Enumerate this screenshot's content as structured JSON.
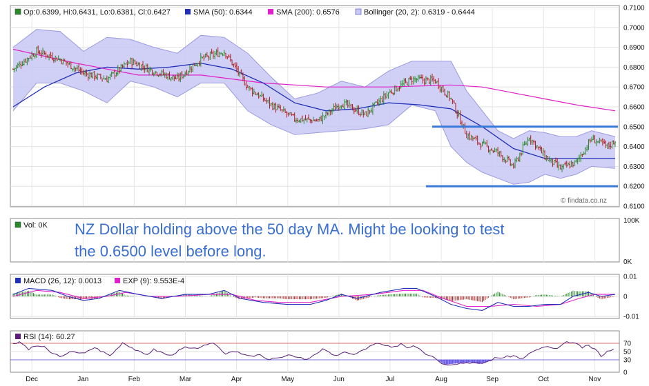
{
  "colors": {
    "up": "#2a8a2a",
    "down": "#b02020",
    "sma50": "#1f2fb8",
    "sma200": "#e020c8",
    "band_fill": "#c8c8f4",
    "band_line": "#9a9ae0",
    "hline": "#3a78d8",
    "macd": "#1f2fb8",
    "exp": "#e020c8",
    "rsi": "#5a1f7a",
    "rsi_fill": "#6a5ae8",
    "rsi70": "#d04040",
    "rsi30": "#4040d0",
    "annotation": "#3a6fd1"
  },
  "legend": {
    "price": "Op:0.6399, Hi:0.6431, Lo:0.6381, Cl:0.6427",
    "sma50": "SMA (50): 0.6344",
    "sma200": "SMA (200): 0.6576",
    "bollinger": "Bollinger (20, 2): 0.6319 - 0.6444",
    "volume": "Vol: 0K",
    "macd": "MACD (26, 12): 0.0013",
    "exp": "EXP (9): 9.553E-4",
    "rsi": "RSI (14): 60.27"
  },
  "annotation": {
    "line1": "NZ Dollar holding above the 50 day MA. Might be looking to test",
    "line2": "the 0.6500 level before long."
  },
  "credit": "© findata.co.nz",
  "chart_data": [
    {
      "type": "candlestick",
      "x_months": [
        "Dec",
        "Jan",
        "Feb",
        "Mar",
        "Apr",
        "May",
        "Jun",
        "Jul",
        "Aug",
        "Sep",
        "Oct",
        "Nov"
      ],
      "y_ticks": [
        "0.6100",
        "0.6200",
        "0.6300",
        "0.6400",
        "0.6500",
        "0.6600",
        "0.6700",
        "0.6800",
        "0.6900",
        "0.7000",
        "0.7100"
      ],
      "ylim": [
        0.61,
        0.71
      ],
      "close_path": [
        [
          0,
          0.679
        ],
        [
          15,
          0.688
        ],
        [
          30,
          0.684
        ],
        [
          45,
          0.677
        ],
        [
          60,
          0.674
        ],
        [
          75,
          0.683
        ],
        [
          90,
          0.678
        ],
        [
          105,
          0.674
        ],
        [
          120,
          0.684
        ],
        [
          135,
          0.688
        ],
        [
          150,
          0.67
        ],
        [
          165,
          0.661
        ],
        [
          180,
          0.654
        ],
        [
          195,
          0.653
        ],
        [
          210,
          0.662
        ],
        [
          225,
          0.656
        ],
        [
          240,
          0.667
        ],
        [
          255,
          0.674
        ],
        [
          270,
          0.673
        ],
        [
          280,
          0.664
        ],
        [
          290,
          0.646
        ],
        [
          300,
          0.641
        ],
        [
          310,
          0.637
        ],
        [
          320,
          0.63
        ],
        [
          330,
          0.645
        ],
        [
          340,
          0.635
        ],
        [
          350,
          0.629
        ],
        [
          360,
          0.632
        ],
        [
          370,
          0.644
        ],
        [
          380,
          0.64
        ],
        [
          385,
          0.643
        ]
      ],
      "sma50_path": [
        [
          0,
          0.66
        ],
        [
          20,
          0.67
        ],
        [
          40,
          0.677
        ],
        [
          60,
          0.68
        ],
        [
          80,
          0.679
        ],
        [
          100,
          0.68
        ],
        [
          120,
          0.682
        ],
        [
          140,
          0.679
        ],
        [
          160,
          0.672
        ],
        [
          180,
          0.662
        ],
        [
          200,
          0.658
        ],
        [
          220,
          0.659
        ],
        [
          240,
          0.662
        ],
        [
          260,
          0.661
        ],
        [
          280,
          0.659
        ],
        [
          300,
          0.65
        ],
        [
          320,
          0.639
        ],
        [
          340,
          0.634
        ],
        [
          360,
          0.634
        ],
        [
          385,
          0.634
        ]
      ],
      "sma200_path": [
        [
          0,
          0.689
        ],
        [
          40,
          0.682
        ],
        [
          80,
          0.676
        ],
        [
          120,
          0.676
        ],
        [
          160,
          0.672
        ],
        [
          200,
          0.67
        ],
        [
          240,
          0.67
        ],
        [
          280,
          0.671
        ],
        [
          300,
          0.67
        ],
        [
          320,
          0.667
        ],
        [
          340,
          0.664
        ],
        [
          360,
          0.661
        ],
        [
          385,
          0.658
        ]
      ],
      "bb_upper_path": [
        [
          0,
          0.69
        ],
        [
          15,
          0.699
        ],
        [
          30,
          0.698
        ],
        [
          45,
          0.688
        ],
        [
          60,
          0.695
        ],
        [
          75,
          0.694
        ],
        [
          90,
          0.69
        ],
        [
          105,
          0.687
        ],
        [
          120,
          0.696
        ],
        [
          135,
          0.695
        ],
        [
          150,
          0.687
        ],
        [
          165,
          0.675
        ],
        [
          180,
          0.664
        ],
        [
          195,
          0.667
        ],
        [
          210,
          0.673
        ],
        [
          225,
          0.67
        ],
        [
          240,
          0.678
        ],
        [
          255,
          0.683
        ],
        [
          270,
          0.683
        ],
        [
          280,
          0.683
        ],
        [
          290,
          0.668
        ],
        [
          300,
          0.658
        ],
        [
          310,
          0.648
        ],
        [
          320,
          0.644
        ],
        [
          330,
          0.648
        ],
        [
          340,
          0.647
        ],
        [
          350,
          0.645
        ],
        [
          360,
          0.645
        ],
        [
          370,
          0.648
        ],
        [
          385,
          0.645
        ]
      ],
      "bb_lower_path": [
        [
          0,
          0.658
        ],
        [
          15,
          0.672
        ],
        [
          30,
          0.672
        ],
        [
          45,
          0.668
        ],
        [
          60,
          0.662
        ],
        [
          75,
          0.673
        ],
        [
          90,
          0.67
        ],
        [
          105,
          0.665
        ],
        [
          120,
          0.672
        ],
        [
          135,
          0.672
        ],
        [
          150,
          0.658
        ],
        [
          165,
          0.651
        ],
        [
          180,
          0.646
        ],
        [
          195,
          0.647
        ],
        [
          210,
          0.648
        ],
        [
          225,
          0.649
        ],
        [
          240,
          0.651
        ],
        [
          255,
          0.661
        ],
        [
          270,
          0.658
        ],
        [
          280,
          0.64
        ],
        [
          290,
          0.632
        ],
        [
          300,
          0.627
        ],
        [
          310,
          0.624
        ],
        [
          320,
          0.621
        ],
        [
          330,
          0.622
        ],
        [
          340,
          0.626
        ],
        [
          350,
          0.624
        ],
        [
          360,
          0.626
        ],
        [
          370,
          0.63
        ],
        [
          385,
          0.629
        ]
      ],
      "resistance": {
        "value": 0.65,
        "x_range": [
          268,
          385
        ]
      },
      "support": {
        "value": 0.62,
        "x_range": [
          264,
          385
        ]
      }
    },
    {
      "type": "bar",
      "name": "volume",
      "y_ticks": [
        "100K",
        "0K"
      ],
      "values": []
    },
    {
      "type": "line",
      "name": "macd",
      "y_ticks": [
        "0.01",
        "0",
        "-0.01"
      ],
      "ylim": [
        -0.011,
        0.011
      ],
      "macd_path": [
        [
          0,
          0.001
        ],
        [
          10,
          0.004
        ],
        [
          25,
          0.003
        ],
        [
          35,
          0.0
        ],
        [
          45,
          -0.002
        ],
        [
          55,
          -0.001
        ],
        [
          68,
          0.003
        ],
        [
          80,
          0.001
        ],
        [
          95,
          -0.001
        ],
        [
          110,
          0.001
        ],
        [
          125,
          0.001
        ],
        [
          135,
          0.003
        ],
        [
          145,
          -0.001
        ],
        [
          160,
          -0.003
        ],
        [
          175,
          -0.004
        ],
        [
          190,
          -0.004
        ],
        [
          200,
          -0.002
        ],
        [
          210,
          0.001
        ],
        [
          220,
          -0.001
        ],
        [
          235,
          0.002
        ],
        [
          250,
          0.004
        ],
        [
          258,
          0.004
        ],
        [
          270,
          0.0
        ],
        [
          280,
          -0.004
        ],
        [
          290,
          -0.006
        ],
        [
          300,
          -0.007
        ],
        [
          310,
          -0.003
        ],
        [
          320,
          -0.005
        ],
        [
          330,
          -0.005
        ],
        [
          340,
          -0.004
        ],
        [
          350,
          -0.004
        ],
        [
          358,
          0.0
        ],
        [
          368,
          0.002
        ],
        [
          376,
          0.0
        ],
        [
          385,
          0.001
        ]
      ],
      "exp_path": [
        [
          0,
          0.0
        ],
        [
          15,
          0.003
        ],
        [
          30,
          0.002
        ],
        [
          45,
          -0.001
        ],
        [
          60,
          0.0
        ],
        [
          72,
          0.002
        ],
        [
          88,
          0.0
        ],
        [
          105,
          0.0
        ],
        [
          125,
          0.001
        ],
        [
          140,
          0.001
        ],
        [
          155,
          -0.002
        ],
        [
          170,
          -0.003
        ],
        [
          190,
          -0.003
        ],
        [
          210,
          0.0
        ],
        [
          230,
          0.001
        ],
        [
          250,
          0.003
        ],
        [
          262,
          0.003
        ],
        [
          275,
          -0.001
        ],
        [
          290,
          -0.005
        ],
        [
          305,
          -0.005
        ],
        [
          320,
          -0.004
        ],
        [
          335,
          -0.005
        ],
        [
          350,
          -0.004
        ],
        [
          362,
          -0.001
        ],
        [
          372,
          0.001
        ],
        [
          385,
          0.001
        ]
      ]
    },
    {
      "type": "line",
      "name": "rsi",
      "y_ticks": [
        "70",
        "50",
        "30",
        "0"
      ],
      "ylim": [
        0,
        100
      ],
      "levels": [
        70,
        30
      ],
      "rsi_path": [
        [
          0,
          70
        ],
        [
          5,
          72
        ],
        [
          10,
          55
        ],
        [
          15,
          65
        ],
        [
          20,
          60
        ],
        [
          25,
          45
        ],
        [
          32,
          38
        ],
        [
          38,
          52
        ],
        [
          45,
          44
        ],
        [
          52,
          60
        ],
        [
          58,
          48
        ],
        [
          62,
          40
        ],
        [
          66,
          55
        ],
        [
          70,
          72
        ],
        [
          75,
          62
        ],
        [
          80,
          50
        ],
        [
          85,
          42
        ],
        [
          90,
          55
        ],
        [
          95,
          48
        ],
        [
          100,
          40
        ],
        [
          105,
          50
        ],
        [
          110,
          60
        ],
        [
          115,
          55
        ],
        [
          120,
          62
        ],
        [
          125,
          65
        ],
        [
          128,
          72
        ],
        [
          132,
          58
        ],
        [
          136,
          45
        ],
        [
          140,
          52
        ],
        [
          146,
          44
        ],
        [
          152,
          38
        ],
        [
          158,
          42
        ],
        [
          162,
          30
        ],
        [
          166,
          35
        ],
        [
          170,
          34
        ],
        [
          176,
          40
        ],
        [
          182,
          38
        ],
        [
          188,
          30
        ],
        [
          192,
          42
        ],
        [
          198,
          55
        ],
        [
          203,
          45
        ],
        [
          208,
          40
        ],
        [
          213,
          50
        ],
        [
          218,
          42
        ],
        [
          223,
          52
        ],
        [
          228,
          62
        ],
        [
          233,
          70
        ],
        [
          238,
          64
        ],
        [
          243,
          58
        ],
        [
          248,
          70
        ],
        [
          252,
          60
        ],
        [
          256,
          65
        ],
        [
          260,
          58
        ],
        [
          264,
          45
        ],
        [
          268,
          40
        ],
        [
          272,
          28
        ],
        [
          276,
          18
        ],
        [
          280,
          20
        ],
        [
          286,
          22
        ],
        [
          292,
          24
        ],
        [
          298,
          20
        ],
        [
          303,
          25
        ],
        [
          308,
          34
        ],
        [
          314,
          36
        ],
        [
          320,
          40
        ],
        [
          326,
          32
        ],
        [
          332,
          50
        ],
        [
          338,
          58
        ],
        [
          343,
          62
        ],
        [
          347,
          54
        ],
        [
          351,
          65
        ],
        [
          355,
          74
        ],
        [
          359,
          70
        ],
        [
          364,
          60
        ],
        [
          368,
          64
        ],
        [
          372,
          56
        ],
        [
          376,
          40
        ],
        [
          380,
          50
        ],
        [
          385,
          60
        ]
      ]
    }
  ]
}
